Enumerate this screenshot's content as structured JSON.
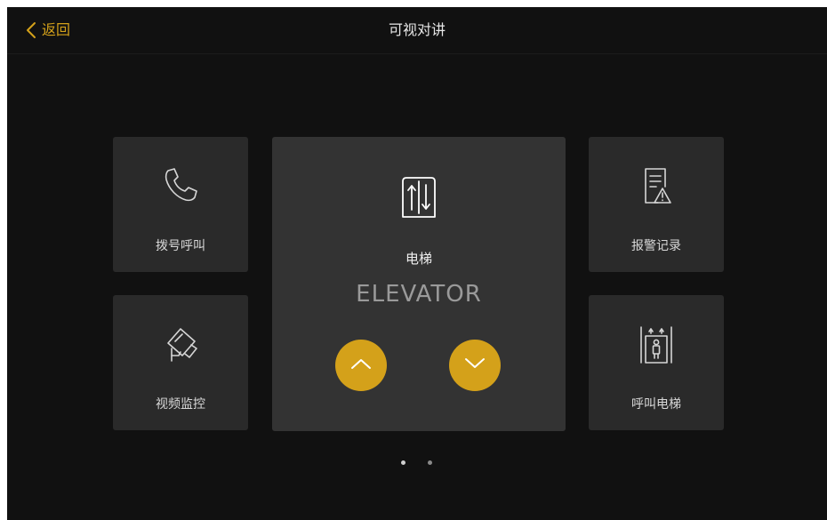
{
  "header": {
    "back_label": "返回",
    "title": "可视对讲"
  },
  "tiles": {
    "dial_call": {
      "label": "拨号呼叫",
      "icon": "phone-icon"
    },
    "video_monitor": {
      "label": "视频监控",
      "icon": "security-camera-icon"
    },
    "alarm_records": {
      "label": "报警记录",
      "icon": "alarm-record-icon"
    },
    "call_elevator": {
      "label": "呼叫电梯",
      "icon": "call-elevator-icon"
    }
  },
  "elevator": {
    "label": "电梯",
    "sub_label": "ELEVATOR",
    "icon": "elevator-icon",
    "up_icon": "chevron-up-icon",
    "down_icon": "chevron-down-icon"
  },
  "pagination": {
    "pages": 2,
    "current": 1
  },
  "colors": {
    "accent": "#d4a11a",
    "background": "#111111",
    "tile": "#2a2a2a",
    "tile_featured": "#333333"
  }
}
